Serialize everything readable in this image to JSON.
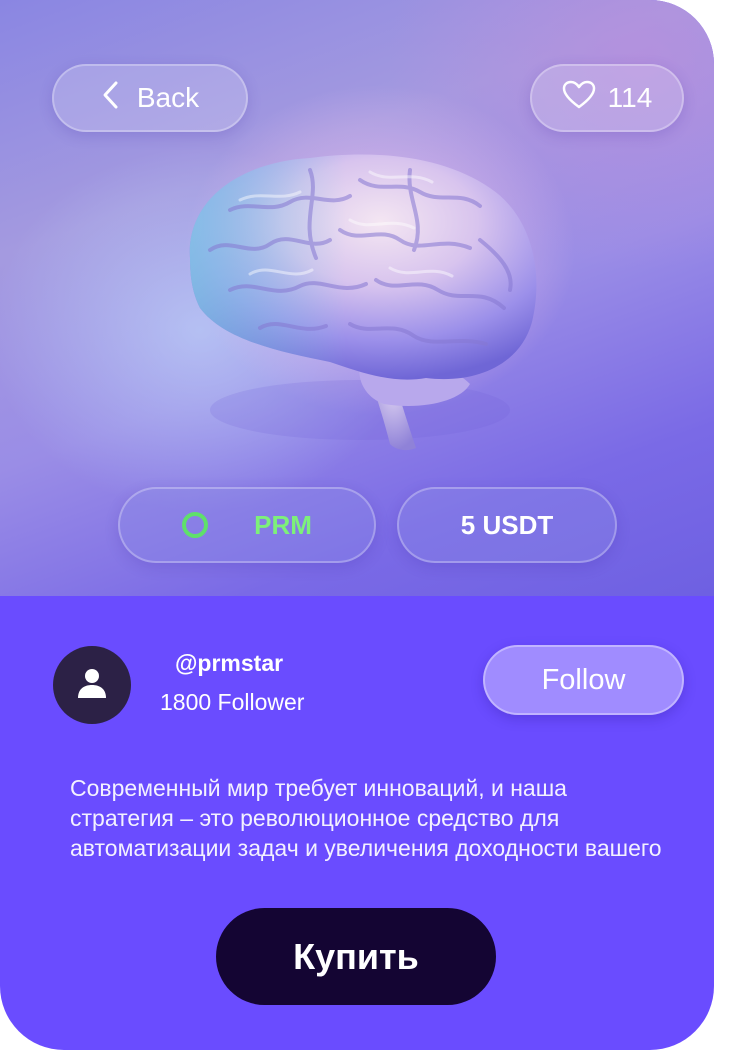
{
  "header": {
    "back_label": "Back",
    "likes_count": "114"
  },
  "hero": {
    "image_alt": "brain-illustration",
    "token_label": "PRM",
    "price_label": "5 USDT"
  },
  "profile": {
    "username": "@prmstar",
    "followers": "1800 Follower",
    "follow_label": "Follow"
  },
  "description": "Современный мир требует инноваций, и наша стратегия – это революционное средство для автоматизации задач и увеличения доходности вашего",
  "buy_label": "Купить",
  "colors": {
    "card_background": "#6a4cff",
    "token_green": "#7df07a",
    "buy_button": "#140533",
    "follow_button": "#a08cff",
    "avatar": "#2c2146"
  },
  "icons": {
    "back": "chevron-left-icon",
    "like": "heart-icon",
    "token": "ring-icon",
    "avatar": "user-icon"
  }
}
